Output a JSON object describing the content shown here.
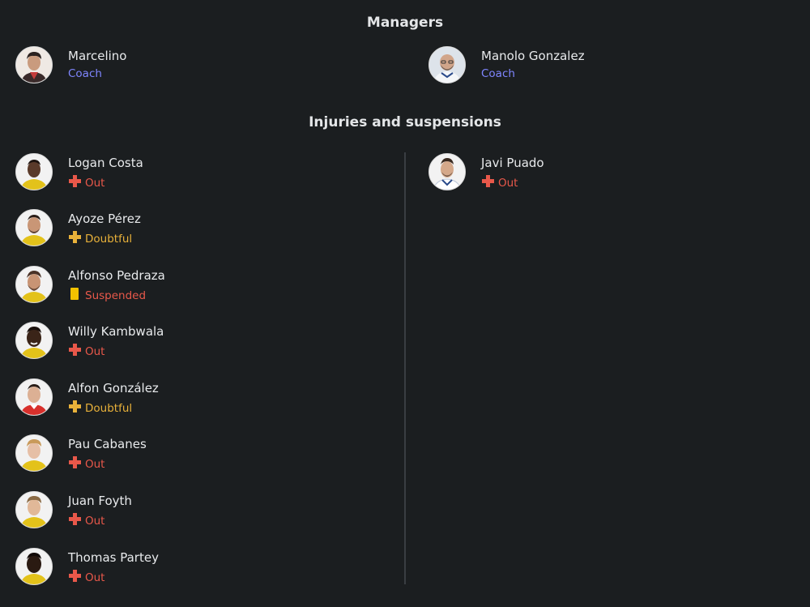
{
  "managers": {
    "title": "Managers",
    "home": {
      "name": "Marcelino",
      "role": "Coach",
      "avatar": "manager-avatar"
    },
    "away": {
      "name": "Manolo Gonzalez",
      "role": "Coach",
      "avatar": "manager-avatar"
    }
  },
  "injuries": {
    "title": "Injuries and suspensions",
    "home": [
      {
        "name": "Logan Costa",
        "status": "Out",
        "status_icon": "cross-icon",
        "status_color": "#e8584a"
      },
      {
        "name": "Ayoze Pérez",
        "status": "Doubtful",
        "status_icon": "cross-icon",
        "status_color": "#e8b13a"
      },
      {
        "name": "Alfonso Pedraza",
        "status": "Suspended",
        "status_icon": "yellow-card-icon",
        "status_color": "#e8584a"
      },
      {
        "name": "Willy Kambwala",
        "status": "Out",
        "status_icon": "cross-icon",
        "status_color": "#e8584a"
      },
      {
        "name": "Alfon González",
        "status": "Doubtful",
        "status_icon": "cross-icon",
        "status_color": "#e8b13a"
      },
      {
        "name": "Pau Cabanes",
        "status": "Out",
        "status_icon": "cross-icon",
        "status_color": "#e8584a"
      },
      {
        "name": "Juan Foyth",
        "status": "Out",
        "status_icon": "cross-icon",
        "status_color": "#e8584a"
      },
      {
        "name": "Thomas Partey",
        "status": "Out",
        "status_icon": "cross-icon",
        "status_color": "#e8584a"
      }
    ],
    "away": [
      {
        "name": "Javi Puado",
        "status": "Out",
        "status_icon": "cross-icon",
        "status_color": "#e8584a"
      }
    ]
  },
  "colors": {
    "background": "#1b1e20",
    "coach": "#7f86ff",
    "out": "#e8584a",
    "doubtful": "#e8b13a",
    "yellow_card": "#f2c200"
  }
}
